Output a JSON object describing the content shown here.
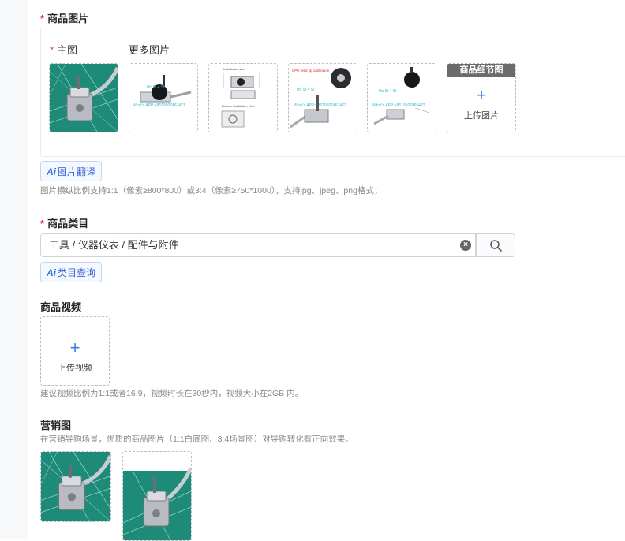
{
  "product_images": {
    "title": "商品图片",
    "main_label": "主图",
    "more_label": "更多图片",
    "detail_upload_header": "商品细节图",
    "upload_text": "上传图片",
    "translate_button": "图片翻译",
    "hint": "图片横纵比例支持1:1（像素≥800*800）或3:4（像素≥750*1000），支持jpg、jpeg、png格式；",
    "thumb_texts": {
      "t2_line1": "Hc  SI  4  SI",
      "t2_line2": "What's APP:+8619507463421",
      "t3_line1": "Installation size",
      "t3_line2": "Bottom installation view",
      "t4_line1": "CPU feed tip calibration",
      "t4_line2": "Hc  SI  4  SI",
      "t4_line3": "What's APP:+8619507463422",
      "t5_line1": "Hc  SI  4  SI",
      "t5_line2": "What's APP:+8619507463422"
    }
  },
  "category": {
    "title": "商品类目",
    "value": "工具 / 仪器仪表 / 配件与附件",
    "ai_button": "类目查询"
  },
  "video": {
    "title": "商品视频",
    "upload_text": "上传视频",
    "hint": "建议视频比例为1:1或者16:9，视频时长在30秒内，视频大小在2GB 内。"
  },
  "marketing": {
    "title": "营销图",
    "hint": "在营销导购场景，优质的商品图片（1:1白底图、3:4场景图）对导购转化有正向效果。"
  },
  "symbols": {
    "required_mark": "*",
    "plus": "+",
    "ai_mark": "Ai",
    "clear_x": "×"
  }
}
